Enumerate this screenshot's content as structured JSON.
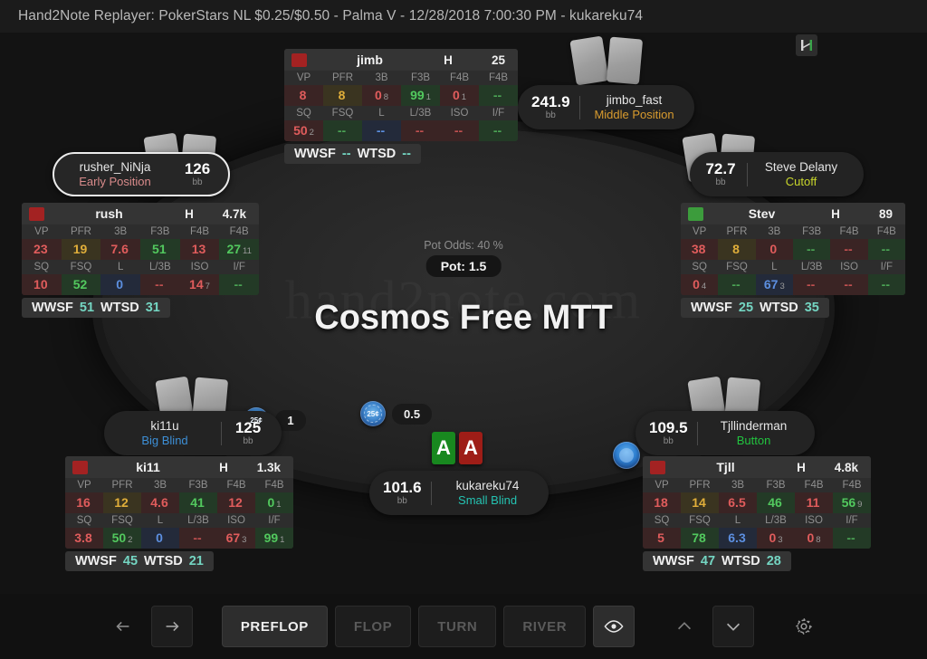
{
  "window": {
    "title": "Hand2Note Replayer: PokerStars NL $0.25/$0.50 - Palma V - 12/28/2018 7:00:30 PM - kukareku74",
    "logo_icon": "hand2note-logo-icon"
  },
  "table": {
    "name": "Cosmos Free MTT",
    "watermark": "hand2note.com",
    "pot_odds": "Pot Odds: 40 %",
    "pot": "Pot: 1.5"
  },
  "hole_cards": [
    {
      "rank": "A",
      "suit": "spade"
    },
    {
      "rank": "A",
      "suit": "heart"
    }
  ],
  "bets": [
    {
      "name": "bet-big-blind",
      "denom": "25¢",
      "amount": "1"
    },
    {
      "name": "bet-small-blind",
      "denom": "25¢",
      "amount": "0.5"
    }
  ],
  "players": [
    {
      "id": "rusher-ninja",
      "name": "rusher_NiNja",
      "position": "Early Position",
      "position_color": "#d98b8b",
      "stack": "126",
      "bb": "bb",
      "order": "name-first",
      "hero_outline": true
    },
    {
      "id": "jimbo-fast",
      "name": "jimbo_fast",
      "position": "Middle Position",
      "position_color": "#d99b2e",
      "stack": "241.9",
      "bb": "bb",
      "order": "stack-first",
      "hero_outline": false
    },
    {
      "id": "steve-delany",
      "name": "Steve Delany",
      "position": "Cutoff",
      "position_color": "#c8d62b",
      "stack": "72.7",
      "bb": "bb",
      "order": "stack-first",
      "hero_outline": false
    },
    {
      "id": "tjllinderman",
      "name": "Tjllinderman",
      "position": "Button",
      "position_color": "#22c33f",
      "stack": "109.5",
      "bb": "bb",
      "order": "stack-first",
      "hero_outline": false
    },
    {
      "id": "kukareku74",
      "name": "kukareku74",
      "position": "Small Blind",
      "position_color": "#24c3b2",
      "stack": "101.6",
      "bb": "bb",
      "order": "stack-first",
      "hero_outline": false
    },
    {
      "id": "ki11u",
      "name": "ki11u",
      "position": "Big Blind",
      "position_color": "#3d8fd6",
      "stack": "125",
      "bb": "bb",
      "order": "name-first",
      "hero_outline": false
    }
  ],
  "hud_labels_row1": [
    "VP",
    "PFR",
    "3B",
    "F3B",
    "F4B",
    "F4B"
  ],
  "hud_labels_row2": [
    "SQ",
    "FSQ",
    "L",
    "L/3B",
    "ISO",
    "I/F"
  ],
  "huds": [
    {
      "id": "hud-rush",
      "swatch": "#a32222",
      "name": "rush",
      "h": "H",
      "stack": "4.7k",
      "row1": [
        {
          "v": "23",
          "c": "#e05c5c",
          "bg": "#3a2424",
          "sub": ""
        },
        {
          "v": "19",
          "c": "#e0ae3a",
          "bg": "#3a3420",
          "sub": ""
        },
        {
          "v": "7.6",
          "c": "#e05c5c",
          "bg": "#3a2424",
          "sub": ""
        },
        {
          "v": "51",
          "c": "#52c95e",
          "bg": "#233a26",
          "sub": ""
        },
        {
          "v": "13",
          "c": "#e05c5c",
          "bg": "#3a2424",
          "sub": ""
        },
        {
          "v": "27",
          "c": "#52c95e",
          "bg": "#233a26",
          "sub": "11"
        }
      ],
      "row2": [
        {
          "v": "10",
          "c": "#e05c5c",
          "bg": "#3a2424",
          "sub": ""
        },
        {
          "v": "52",
          "c": "#52c95e",
          "bg": "#233a26",
          "sub": ""
        },
        {
          "v": "0",
          "c": "#5c8fe0",
          "bg": "#232a3a",
          "sub": ""
        },
        {
          "v": "--",
          "c": "#c05050",
          "bg": "#3a2424",
          "sub": ""
        },
        {
          "v": "14",
          "c": "#e05c5c",
          "bg": "#3a2424",
          "sub": "7"
        },
        {
          "v": "--",
          "c": "#4ba455",
          "bg": "#233a26",
          "sub": ""
        }
      ],
      "wwsf_label": "WWSF",
      "wwsf": "51",
      "wtsd_label": "WTSD",
      "wtsd": "31"
    },
    {
      "id": "hud-jimb",
      "swatch": "#a32222",
      "name": "jimb",
      "h": "H",
      "stack": "25",
      "row1": [
        {
          "v": "8",
          "c": "#e05c5c",
          "bg": "#3a2424",
          "sub": ""
        },
        {
          "v": "8",
          "c": "#e0ae3a",
          "bg": "#3a3420",
          "sub": ""
        },
        {
          "v": "0",
          "c": "#e05c5c",
          "bg": "#3a2424",
          "sub": "8"
        },
        {
          "v": "99",
          "c": "#52c95e",
          "bg": "#233a26",
          "sub": "1"
        },
        {
          "v": "0",
          "c": "#e05c5c",
          "bg": "#3a2424",
          "sub": "1"
        },
        {
          "v": "--",
          "c": "#4ba455",
          "bg": "#233a26",
          "sub": ""
        }
      ],
      "row2": [
        {
          "v": "50",
          "c": "#e05c5c",
          "bg": "#3a2424",
          "sub": "2"
        },
        {
          "v": "--",
          "c": "#4ba455",
          "bg": "#233a26",
          "sub": ""
        },
        {
          "v": "--",
          "c": "#5c8fe0",
          "bg": "#232a3a",
          "sub": ""
        },
        {
          "v": "--",
          "c": "#c05050",
          "bg": "#3a2424",
          "sub": ""
        },
        {
          "v": "--",
          "c": "#c05050",
          "bg": "#3a2424",
          "sub": ""
        },
        {
          "v": "--",
          "c": "#4ba455",
          "bg": "#233a26",
          "sub": ""
        }
      ],
      "wwsf_label": "WWSF",
      "wwsf": "--",
      "wtsd_label": "WTSD",
      "wtsd": "--"
    },
    {
      "id": "hud-stev",
      "swatch": "#3c9c3c",
      "name": "Stev",
      "h": "H",
      "stack": "89",
      "row1": [
        {
          "v": "38",
          "c": "#e05c5c",
          "bg": "#3a2424",
          "sub": ""
        },
        {
          "v": "8",
          "c": "#e0ae3a",
          "bg": "#3a3420",
          "sub": ""
        },
        {
          "v": "0",
          "c": "#e05c5c",
          "bg": "#3a2424",
          "sub": ""
        },
        {
          "v": "--",
          "c": "#4ba455",
          "bg": "#233a26",
          "sub": ""
        },
        {
          "v": "--",
          "c": "#c05050",
          "bg": "#3a2424",
          "sub": ""
        },
        {
          "v": "--",
          "c": "#4ba455",
          "bg": "#233a26",
          "sub": ""
        }
      ],
      "row2": [
        {
          "v": "0",
          "c": "#e05c5c",
          "bg": "#3a2424",
          "sub": "4"
        },
        {
          "v": "--",
          "c": "#4ba455",
          "bg": "#233a26",
          "sub": ""
        },
        {
          "v": "67",
          "c": "#5c8fe0",
          "bg": "#232a3a",
          "sub": "3"
        },
        {
          "v": "--",
          "c": "#c05050",
          "bg": "#3a2424",
          "sub": ""
        },
        {
          "v": "--",
          "c": "#c05050",
          "bg": "#3a2424",
          "sub": ""
        },
        {
          "v": "--",
          "c": "#4ba455",
          "bg": "#233a26",
          "sub": ""
        }
      ],
      "wwsf_label": "WWSF",
      "wwsf": "25",
      "wtsd_label": "WTSD",
      "wtsd": "35"
    },
    {
      "id": "hud-ki11",
      "swatch": "#a32222",
      "name": "ki11",
      "h": "H",
      "stack": "1.3k",
      "row1": [
        {
          "v": "16",
          "c": "#e05c5c",
          "bg": "#3a2424",
          "sub": ""
        },
        {
          "v": "12",
          "c": "#e0ae3a",
          "bg": "#3a3420",
          "sub": ""
        },
        {
          "v": "4.6",
          "c": "#e05c5c",
          "bg": "#3a2424",
          "sub": ""
        },
        {
          "v": "41",
          "c": "#52c95e",
          "bg": "#233a26",
          "sub": ""
        },
        {
          "v": "12",
          "c": "#e05c5c",
          "bg": "#3a2424",
          "sub": ""
        },
        {
          "v": "0",
          "c": "#52c95e",
          "bg": "#233a26",
          "sub": "1"
        }
      ],
      "row2": [
        {
          "v": "3.8",
          "c": "#e05c5c",
          "bg": "#3a2424",
          "sub": ""
        },
        {
          "v": "50",
          "c": "#52c95e",
          "bg": "#233a26",
          "sub": "2"
        },
        {
          "v": "0",
          "c": "#5c8fe0",
          "bg": "#232a3a",
          "sub": ""
        },
        {
          "v": "--",
          "c": "#c05050",
          "bg": "#3a2424",
          "sub": ""
        },
        {
          "v": "67",
          "c": "#e05c5c",
          "bg": "#3a2424",
          "sub": "3"
        },
        {
          "v": "99",
          "c": "#52c95e",
          "bg": "#233a26",
          "sub": "1"
        }
      ],
      "wwsf_label": "WWSF",
      "wwsf": "45",
      "wtsd_label": "WTSD",
      "wtsd": "21"
    },
    {
      "id": "hud-tjll",
      "swatch": "#a32222",
      "name": "Tjll",
      "h": "H",
      "stack": "4.8k",
      "row1": [
        {
          "v": "18",
          "c": "#e05c5c",
          "bg": "#3a2424",
          "sub": ""
        },
        {
          "v": "14",
          "c": "#e0ae3a",
          "bg": "#3a3420",
          "sub": ""
        },
        {
          "v": "6.5",
          "c": "#e05c5c",
          "bg": "#3a2424",
          "sub": ""
        },
        {
          "v": "46",
          "c": "#52c95e",
          "bg": "#233a26",
          "sub": ""
        },
        {
          "v": "11",
          "c": "#e05c5c",
          "bg": "#3a2424",
          "sub": ""
        },
        {
          "v": "56",
          "c": "#52c95e",
          "bg": "#233a26",
          "sub": "9"
        }
      ],
      "row2": [
        {
          "v": "5",
          "c": "#e05c5c",
          "bg": "#3a2424",
          "sub": ""
        },
        {
          "v": "78",
          "c": "#52c95e",
          "bg": "#233a26",
          "sub": ""
        },
        {
          "v": "6.3",
          "c": "#5c8fe0",
          "bg": "#232a3a",
          "sub": ""
        },
        {
          "v": "0",
          "c": "#e05c5c",
          "bg": "#3a2424",
          "sub": "3"
        },
        {
          "v": "0",
          "c": "#e05c5c",
          "bg": "#3a2424",
          "sub": "8"
        },
        {
          "v": "--",
          "c": "#4ba455",
          "bg": "#233a26",
          "sub": ""
        }
      ],
      "wwsf_label": "WWSF",
      "wwsf": "47",
      "wtsd_label": "WTSD",
      "wtsd": "28"
    }
  ],
  "toolbar": {
    "back_icon": "arrow-left-icon",
    "forward_icon": "arrow-right-icon",
    "preflop": "PREFLOP",
    "flop": "FLOP",
    "turn": "TURN",
    "river": "RIVER",
    "eye_icon": "eye-icon",
    "up_icon": "chevron-up-icon",
    "down_icon": "chevron-down-icon",
    "settings_icon": "gear-icon"
  }
}
